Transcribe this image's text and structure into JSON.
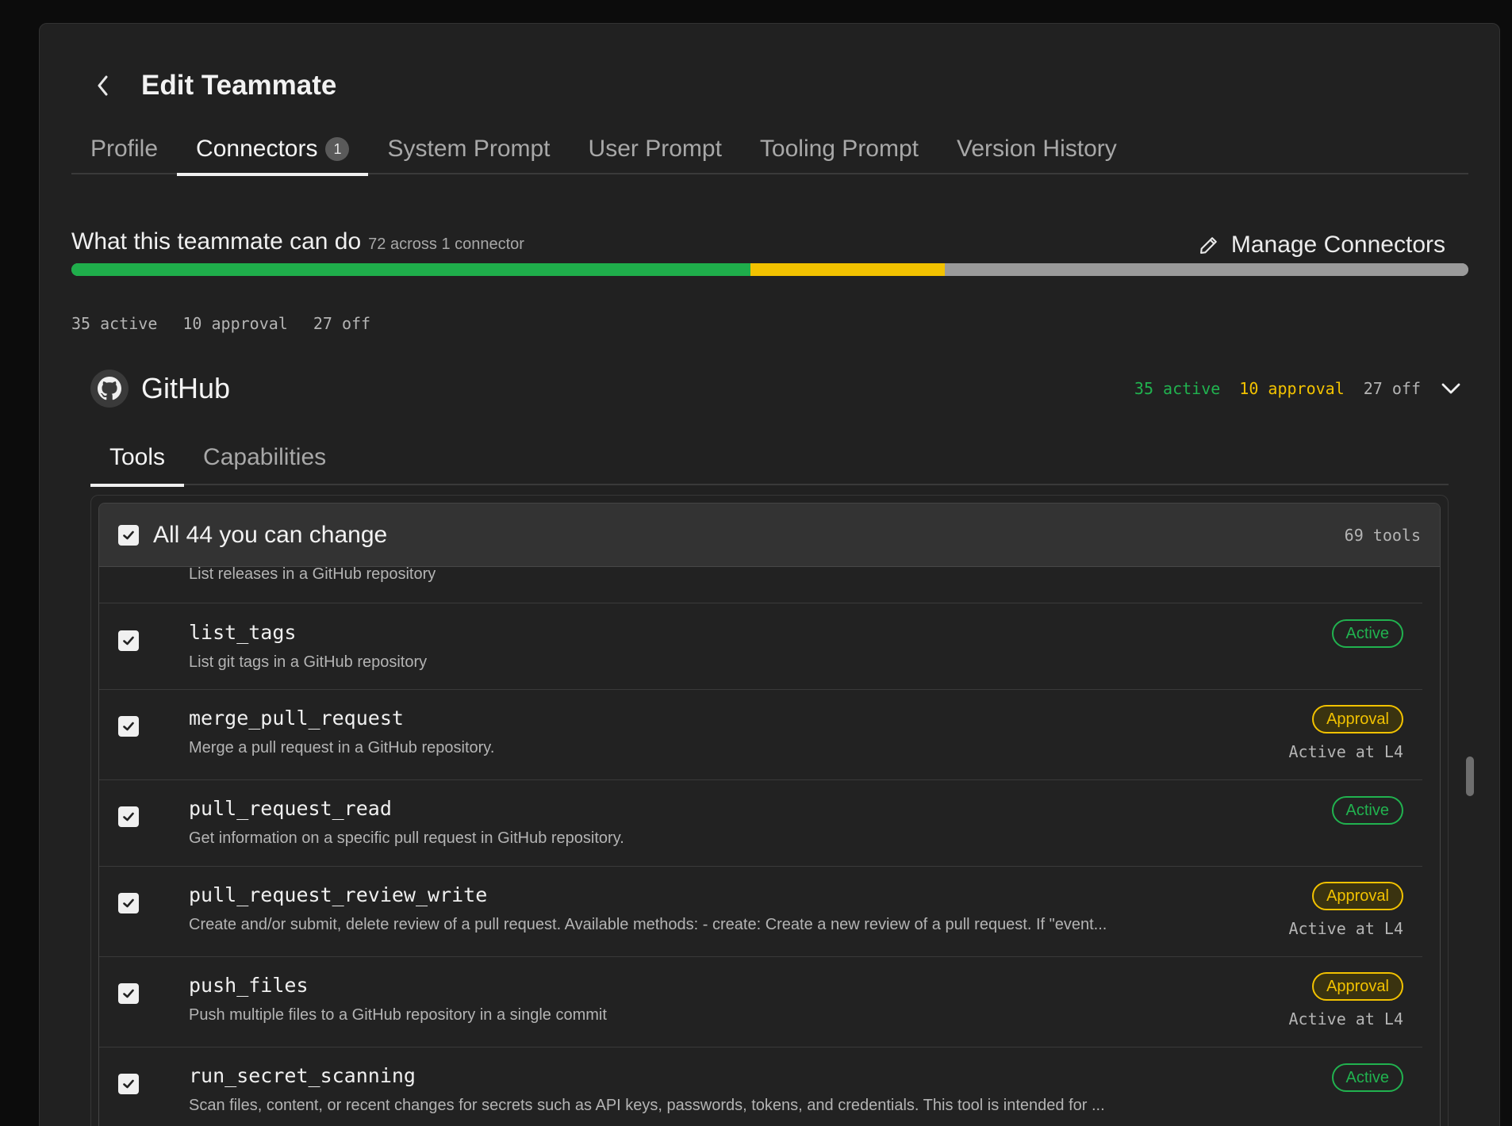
{
  "header": {
    "title": "Edit Teammate"
  },
  "tabs": [
    {
      "label": "Profile"
    },
    {
      "label": "Connectors",
      "badge": "1"
    },
    {
      "label": "System Prompt"
    },
    {
      "label": "User Prompt"
    },
    {
      "label": "Tooling Prompt"
    },
    {
      "label": "Version History"
    }
  ],
  "summary": {
    "title": "What this teammate can do",
    "subtitle": "72 across 1 connector",
    "manage_label": "Manage Connectors",
    "active": 35,
    "approval": 10,
    "off": 27,
    "active_label": "35 active",
    "approval_label": "10 approval",
    "off_label": "27 off",
    "colors": {
      "active": "#1fae4b",
      "approval": "#f2c200",
      "off": "#9a9a9a"
    }
  },
  "connector": {
    "name": "GitHub",
    "icon": "github-icon",
    "active_label": "35 active",
    "approval_label": "10 approval",
    "off_label": "27 off"
  },
  "subtabs": [
    {
      "label": "Tools"
    },
    {
      "label": "Capabilities"
    }
  ],
  "list": {
    "header_label": "All 44 you can change",
    "tool_count": "69 tools",
    "partial_desc": "List releases in a GitHub repository",
    "rows": [
      {
        "name": "list_tags",
        "desc": "List git tags in a GitHub repository",
        "status": "Active"
      },
      {
        "name": "merge_pull_request",
        "desc": "Merge a pull request in a GitHub repository.",
        "status": "Approval",
        "note": "Active at L4"
      },
      {
        "name": "pull_request_read",
        "desc": "Get information on a specific pull request in GitHub repository.",
        "status": "Active"
      },
      {
        "name": "pull_request_review_write",
        "desc": "Create and/or submit, delete review of a pull request. Available methods: - create: Create a new review of a pull request. If \"event...",
        "status": "Approval",
        "note": "Active at L4"
      },
      {
        "name": "push_files",
        "desc": "Push multiple files to a GitHub repository in a single commit",
        "status": "Approval",
        "note": "Active at L4"
      },
      {
        "name": "run_secret_scanning",
        "desc": "Scan files, content, or recent changes for secrets such as API keys, passwords, tokens, and credentials. This tool is intended for ...",
        "status": "Active"
      }
    ]
  }
}
